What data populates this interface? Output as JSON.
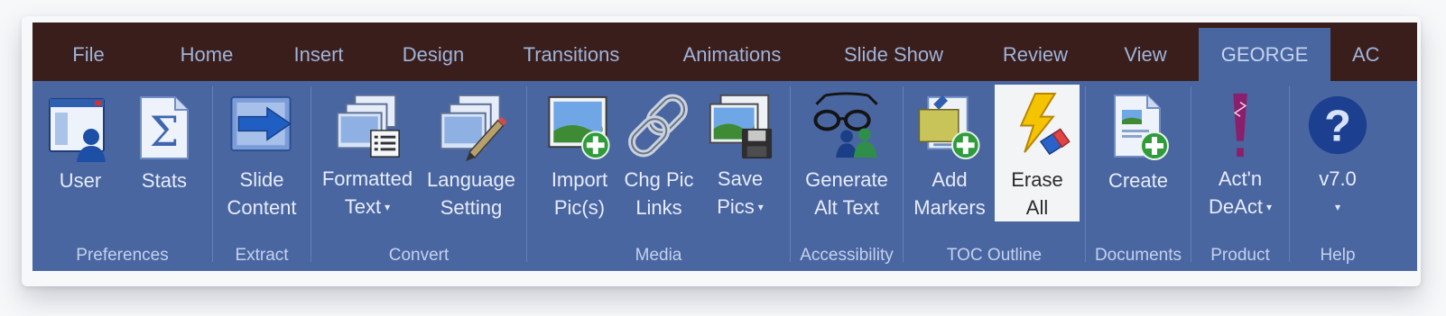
{
  "tabs": [
    {
      "label": "File"
    },
    {
      "label": "Home"
    },
    {
      "label": "Insert"
    },
    {
      "label": "Design"
    },
    {
      "label": "Transitions"
    },
    {
      "label": "Animations"
    },
    {
      "label": "Slide Show"
    },
    {
      "label": "Review"
    },
    {
      "label": "View"
    },
    {
      "label": "GEORGE",
      "active": true
    },
    {
      "label": "AC"
    }
  ],
  "groups": {
    "preferences": {
      "label": "Preferences",
      "buttons": {
        "user": {
          "line1": "User",
          "line2": "",
          "icon": "user-window-icon"
        },
        "stats": {
          "line1": "Stats",
          "line2": "",
          "icon": "sigma-document-icon"
        }
      }
    },
    "extract": {
      "label": "Extract",
      "buttons": {
        "slide_content": {
          "line1": "Slide",
          "line2": "Content",
          "icon": "arrow-slide-icon"
        }
      }
    },
    "convert": {
      "label": "Convert",
      "buttons": {
        "formatted_text": {
          "line1": "Formatted",
          "line2": "Text",
          "dropdown": true,
          "icon": "stacked-slides-list-icon"
        },
        "language_setting": {
          "line1": "Language",
          "line2": "Setting",
          "icon": "stacked-slides-pencil-icon"
        }
      }
    },
    "media": {
      "label": "Media",
      "buttons": {
        "import_pics": {
          "line1": "Import",
          "line2": "Pic(s)",
          "icon": "picture-add-icon"
        },
        "chg_pic_links": {
          "line1": "Chg Pic",
          "line2": "Links",
          "icon": "chain-link-icon"
        },
        "save_pics": {
          "line1": "Save",
          "line2": "Pics",
          "dropdown": true,
          "icon": "pictures-save-icon"
        }
      }
    },
    "accessibility": {
      "label": "Accessibility",
      "buttons": {
        "generate_alt_text": {
          "line1": "Generate",
          "line2": "Alt Text",
          "icon": "glasses-people-icon"
        }
      }
    },
    "toc_outline": {
      "label": "TOC Outline",
      "buttons": {
        "add_markers": {
          "line1": "Add",
          "line2": "Markers",
          "icon": "note-add-icon"
        },
        "erase_all": {
          "line1": "Erase",
          "line2": "All",
          "active": true,
          "icon": "lightning-eraser-icon"
        }
      }
    },
    "documents": {
      "label": "Documents",
      "buttons": {
        "create": {
          "line1": "Create",
          "line2": "",
          "icon": "document-add-icon"
        }
      }
    },
    "product": {
      "label": "Product",
      "buttons": {
        "actn_deact": {
          "line1": "Act'n",
          "line2": "DeAct",
          "dropdown": true,
          "icon": "exclamation-icon"
        }
      }
    },
    "help": {
      "label": "Help",
      "buttons": {
        "version": {
          "line1": "v7.0",
          "line2": "",
          "dropdown": true,
          "icon": "question-circle-icon"
        }
      }
    }
  },
  "colors": {
    "tab_bar": "#3a1e1b",
    "ribbon": "#4a66a1",
    "active_tab": "#4a66a1",
    "active_button": "#f3f4f6"
  }
}
